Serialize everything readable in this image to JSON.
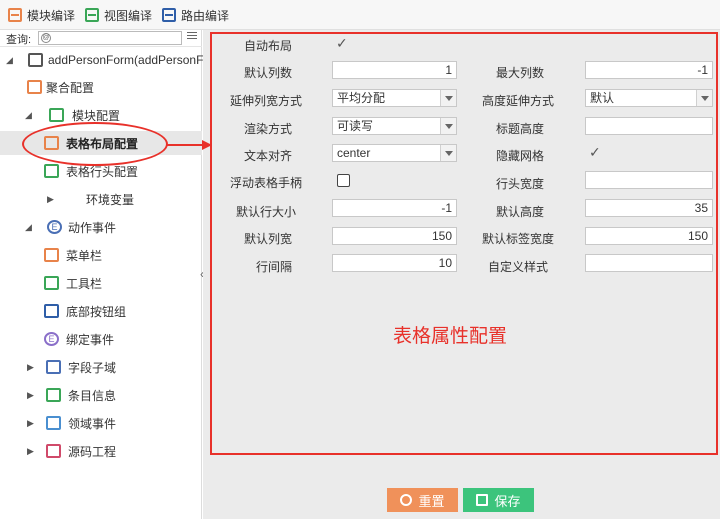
{
  "toolbar": {
    "items": [
      {
        "label": "模块编译",
        "icon": "module-compile-icon",
        "color": "#e8834a"
      },
      {
        "label": "视图编译",
        "icon": "view-compile-icon",
        "color": "#3aa657"
      },
      {
        "label": "路由编译",
        "icon": "route-compile-icon",
        "color": "#2f5ea8"
      }
    ]
  },
  "sidebar": {
    "query_label": "查询:",
    "tree": [
      {
        "label": "addPersonForm(addPersonForm",
        "icon": "form-icon",
        "level": 0,
        "expanded": true
      },
      {
        "label": "聚合配置",
        "icon": "aggregate-icon",
        "level": 1
      },
      {
        "label": "模块配置",
        "icon": "module-icon",
        "level": 1,
        "expanded": true
      },
      {
        "label": "表格布局配置",
        "icon": "table-layout-icon",
        "level": 2,
        "selected": true
      },
      {
        "label": "表格行头配置",
        "icon": "table-header-icon",
        "level": 2
      },
      {
        "label": "环境变量",
        "icon": "",
        "level": 2,
        "collapsed": true
      },
      {
        "label": "动作事件",
        "icon": "event-icon",
        "level": 1,
        "expanded": true
      },
      {
        "label": "菜单栏",
        "icon": "menu-icon",
        "level": 2
      },
      {
        "label": "工具栏",
        "icon": "toolbar-icon",
        "level": 2
      },
      {
        "label": "底部按钮组",
        "icon": "bottom-buttons-icon",
        "level": 2
      },
      {
        "label": "绑定事件",
        "icon": "bind-event-icon",
        "level": 2
      },
      {
        "label": "字段子域",
        "icon": "field-icon",
        "level": 1,
        "collapsed": true
      },
      {
        "label": "条目信息",
        "icon": "item-info-icon",
        "level": 1,
        "collapsed": true
      },
      {
        "label": "领域事件",
        "icon": "domain-event-icon",
        "level": 1,
        "collapsed": true
      },
      {
        "label": "源码工程",
        "icon": "source-icon",
        "level": 1,
        "collapsed": true
      }
    ]
  },
  "form": {
    "auto_layout": {
      "label": "自动布局",
      "checked": true
    },
    "default_cols": {
      "label": "默认列数",
      "value": "1"
    },
    "max_cols": {
      "label": "最大列数",
      "value": "-1"
    },
    "col_stretch": {
      "label": "延伸列宽方式",
      "value": "平均分配"
    },
    "height_stretch": {
      "label": "高度延伸方式",
      "value": "默认"
    },
    "render_mode": {
      "label": "渲染方式",
      "value": "可读写"
    },
    "title_height": {
      "label": "标题高度",
      "value": ""
    },
    "text_align": {
      "label": "文本对齐",
      "value": "center"
    },
    "hide_grid": {
      "label": "隐藏网格",
      "checked": true
    },
    "float_handle": {
      "label": "浮动表格手柄",
      "checked": false
    },
    "row_header_width": {
      "label": "行头宽度",
      "value": ""
    },
    "default_row_size": {
      "label": "默认行大小",
      "value": "-1"
    },
    "default_height": {
      "label": "默认高度",
      "value": "35"
    },
    "default_col_width": {
      "label": "默认列宽",
      "value": "150"
    },
    "default_label_width": {
      "label": "默认标签宽度",
      "value": "150"
    },
    "row_spacing": {
      "label": "行间隔",
      "value": "10"
    },
    "custom_style": {
      "label": "自定义样式",
      "value": ""
    }
  },
  "annotation": "表格属性配置",
  "buttons": {
    "reset": "重置",
    "save": "保存"
  },
  "colors": {
    "accent_red": "#e8312a",
    "reset_orange": "#f0915a",
    "save_green": "#3cc47c"
  }
}
